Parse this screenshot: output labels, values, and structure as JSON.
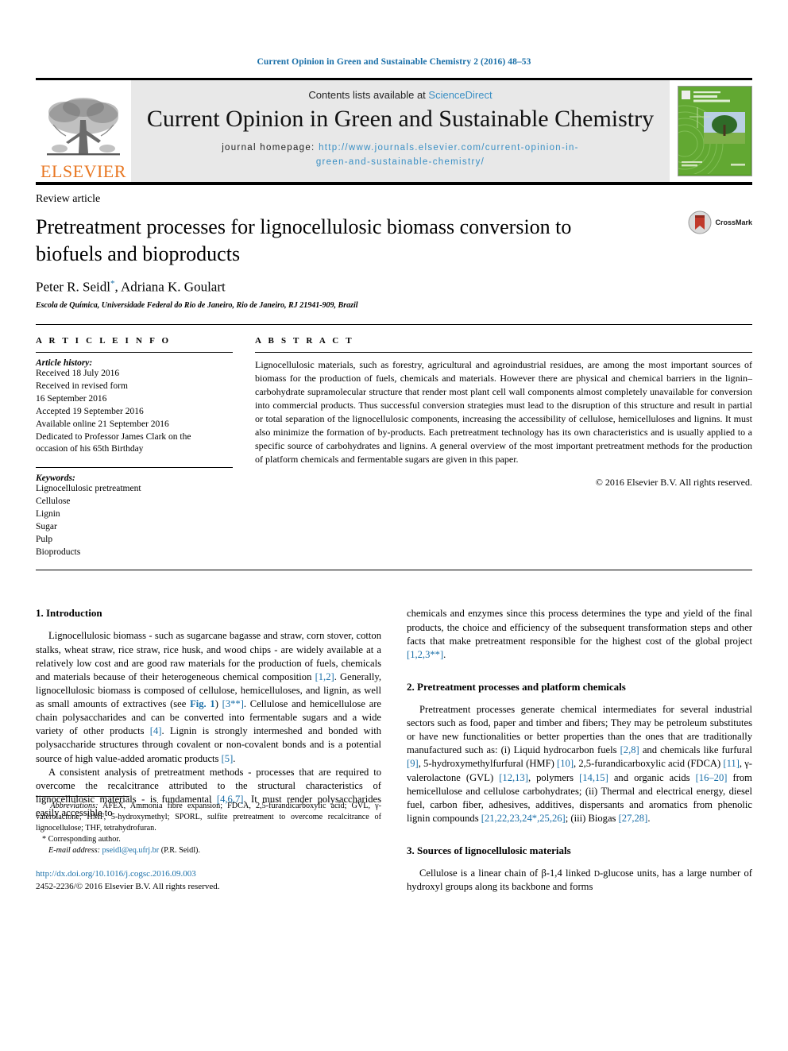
{
  "running_head": "Current Opinion in Green and Sustainable Chemistry 2 (2016) 48–53",
  "colors": {
    "link": "#1a6fa8",
    "sciencedirect": "#3a8fc4",
    "elsevier_orange": "#e87722",
    "masthead_bg": "#e8e8e8",
    "cover_green": "#5ba32b"
  },
  "masthead": {
    "publisher_wordmark": "ELSEVIER",
    "contents_prefix": "Contents lists available at ",
    "contents_link": "ScienceDirect",
    "journal_title": "Current Opinion in Green and Sustainable Chemistry",
    "homepage_label": "journal homepage:",
    "homepage_url_line1": "http://www.journals.elsevier.com/current-opinion-in-",
    "homepage_url_line2": "green-and-sustainable-chemistry/",
    "cover": {
      "line1": "Current Opinion in",
      "line2": "Green and",
      "line3": "Sustainable Chemistry",
      "footer_left": "Availableonline at",
      "footer_left2": "ScienceDirect",
      "footer_right": "Elsevier"
    }
  },
  "article": {
    "kicker": "Review article",
    "title": "Pretreatment processes for lignocellulosic biomass conversion to biofuels and bioproducts",
    "authors": "Peter R. Seidl, Adriana K. Goulart",
    "author1": "Peter R. Seidl",
    "author_sep": ", ",
    "author2": "Adriana K. Goulart",
    "corresponding_marker": "*",
    "affiliation": "Escola de Química, Universidade Federal do Rio de Janeiro, Rio de Janeiro, RJ 21941-909, Brazil",
    "crossmark_label": "CrossMark"
  },
  "article_info": {
    "heading": "A R T I C L E  I N F O",
    "history_label": "Article history:",
    "history": [
      "Received 18 July 2016",
      "Received in revised form",
      "16 September 2016",
      "Accepted 19 September 2016",
      "Available online 21 September 2016",
      "Dedicated to Professor James Clark on the",
      "occasion of his 65th Birthday"
    ],
    "keywords_label": "Keywords:",
    "keywords": [
      "Lignocellulosic pretreatment",
      "Cellulose",
      "Lignin",
      "Sugar",
      "Pulp",
      "Bioproducts"
    ]
  },
  "abstract": {
    "heading": "A B S T R A C T",
    "text": "Lignocellulosic materials, such as forestry, agricultural and agroindustrial residues, are among the most important sources of biomass for the production of fuels, chemicals and materials. However there are physical and chemical barriers in the lignin–carbohydrate supramolecular structure that render most plant cell wall components almost completely unavailable for conversion into commercial products. Thus successful conversion strategies must lead to the disruption of this structure and result in partial or total separation of the lignocellulosic components, increasing the accessibility of cellulose, hemicelluloses and lignins. It must also minimize the formation of by-products. Each pretreatment technology has its own characteristics and is usually applied to a specific source of carbohydrates and lignins. A general overview of the most important pretreatment methods for the production of platform chemicals and fermentable sugars are given in this paper.",
    "copyright": "© 2016 Elsevier B.V. All rights reserved."
  },
  "body": {
    "left_column": {
      "section1_heading": "1. Introduction",
      "p1_a": "Lignocellulosic biomass - such as sugarcane bagasse and straw, corn stover, cotton stalks, wheat straw, rice straw, rice husk, and wood chips - are widely available at a relatively low cost and are good raw materials for the production of fuels, chemicals and materials because of their heterogeneous chemical composition ",
      "p1_ref1": "[1,2]",
      "p1_b": ". Generally, lignocellulosic biomass is composed of cellulose, hemicelluloses, and lignin, as well as small amounts of extractives (see ",
      "p1_figlink": "Fig. 1",
      "p1_c": ") ",
      "p1_ref2": "[3**]",
      "p1_d": ". Cellulose and hemicellulose are chain polysaccharides and can be converted into fermentable sugars and a wide variety of other products ",
      "p1_ref3": "[4]",
      "p1_e": ". Lignin is strongly intermeshed and bonded with polysaccharide structures through covalent or non-covalent bonds and is a potential source of high value-added aromatic products ",
      "p1_ref4": "[5]",
      "p1_f": ".",
      "p2_a": "A consistent analysis of pretreatment methods - processes that are required to overcome the recalcitrance attributed to the structural characteristics of lignocellulosic materials - is fundamental ",
      "p2_ref1": "[4,6,7]",
      "p2_b": ". It must render polysaccharides easily accessible to"
    },
    "right_column": {
      "p3_a": "chemicals and enzymes since this process determines the type and yield of the final products, the choice and efficiency of the subsequent transformation steps and other facts that make pretreatment responsible for the highest cost of the global project ",
      "p3_ref1": "[1,2,3**]",
      "p3_b": ".",
      "section2_heading": "2. Pretreatment processes and platform chemicals",
      "p4_a": "Pretreatment processes generate chemical intermediates for several industrial sectors such as food, paper and timber and fibers; They may be petroleum substitutes or have new functionalities or better properties than the ones that are traditionally manufactured such as: (i) Liquid hydrocarbon fuels ",
      "p4_ref1": "[2,8]",
      "p4_b": " and chemicals like furfural ",
      "p4_ref2": "[9]",
      "p4_c": ", 5-hydroxymethylfurfural (HMF) ",
      "p4_ref3": "[10]",
      "p4_d": ", 2,5-furandicarboxylic acid (FDCA) ",
      "p4_ref4": "[11]",
      "p4_e": ", γ-valerolactone (GVL) ",
      "p4_ref5": "[12,13]",
      "p4_f": ", polymers ",
      "p4_ref6": "[14,15]",
      "p4_g": " and organic acids ",
      "p4_ref7": "[16–20]",
      "p4_h": " from hemicellulose and cellulose carbohydrates; (ii) Thermal and electrical energy, diesel fuel, carbon fiber, adhesives, additives, dispersants and aromatics from phenolic lignin compounds ",
      "p4_ref8": "[21,22,23,24*,25,26]",
      "p4_i": "; (iii) Biogas ",
      "p4_ref9": "[27,28]",
      "p4_j": ".",
      "section3_heading": "3. Sources of lignocellulosic materials",
      "p5_a": "Cellulose is a linear chain of β-1,4 linked ",
      "p5_small": "D",
      "p5_b": "-glucose units, has a large number of hydroxyl groups along its backbone and forms"
    }
  },
  "footnote": {
    "abbrev_label": "Abbreviations:",
    "abbrev_text": " AFEX, Ammonia fibre expansion; FDCA, 2,5-furandicarboxylic acid; GVL, γ-valerolactone; HMF, 5-hydroxymethyl; SPORL, sulfite pretreatment to overcome recalcitrance of lignocellulose; THF, tetrahydrofuran.",
    "corresponding": "* Corresponding author.",
    "email_label": "E-mail address:",
    "email": "pseidl@eq.ufrj.br",
    "email_suffix": " (P.R. Seidl).",
    "doi": "http://dx.doi.org/10.1016/j.cogsc.2016.09.003",
    "issn_line": "2452-2236/© 2016 Elsevier B.V. All rights reserved."
  }
}
